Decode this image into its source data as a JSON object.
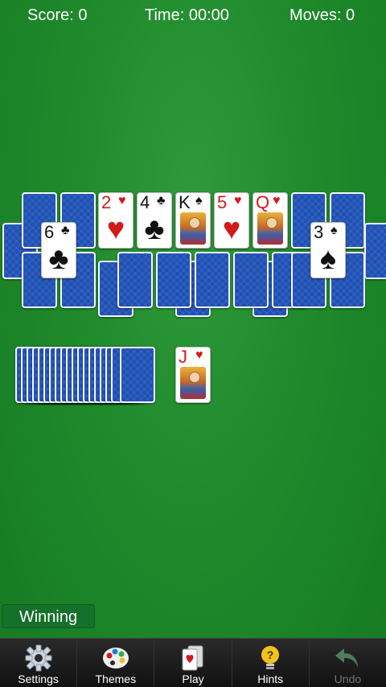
{
  "hud": {
    "score": "Score: 0",
    "time": "Time: 00:00",
    "moves": "Moves: 0"
  },
  "top_row_faceup": [
    {
      "rank": "2",
      "suit": "♥",
      "color": "red"
    },
    {
      "rank": "4",
      "suit": "♣",
      "color": "black"
    },
    {
      "rank": "K",
      "suit": "♠",
      "color": "black",
      "portrait": true
    },
    {
      "rank": "5",
      "suit": "♥",
      "color": "red"
    },
    {
      "rank": "Q",
      "suit": "♥",
      "color": "red",
      "portrait": true
    }
  ],
  "left_faceup": {
    "rank": "6",
    "suit": "♣",
    "color": "black"
  },
  "right_faceup": {
    "rank": "3",
    "suit": "♠",
    "color": "black"
  },
  "waste_card": {
    "rank": "J",
    "suit": "♥",
    "color": "red",
    "portrait": true
  },
  "status": {
    "winning": "Winning"
  },
  "toolbar": {
    "settings": "Settings",
    "themes": "Themes",
    "play": "Play",
    "hints": "Hints",
    "undo": "Undo"
  },
  "colors": {
    "felt": "#1f8a2c",
    "card_back": "#1e50b5",
    "red_suit": "#d21a1a"
  }
}
